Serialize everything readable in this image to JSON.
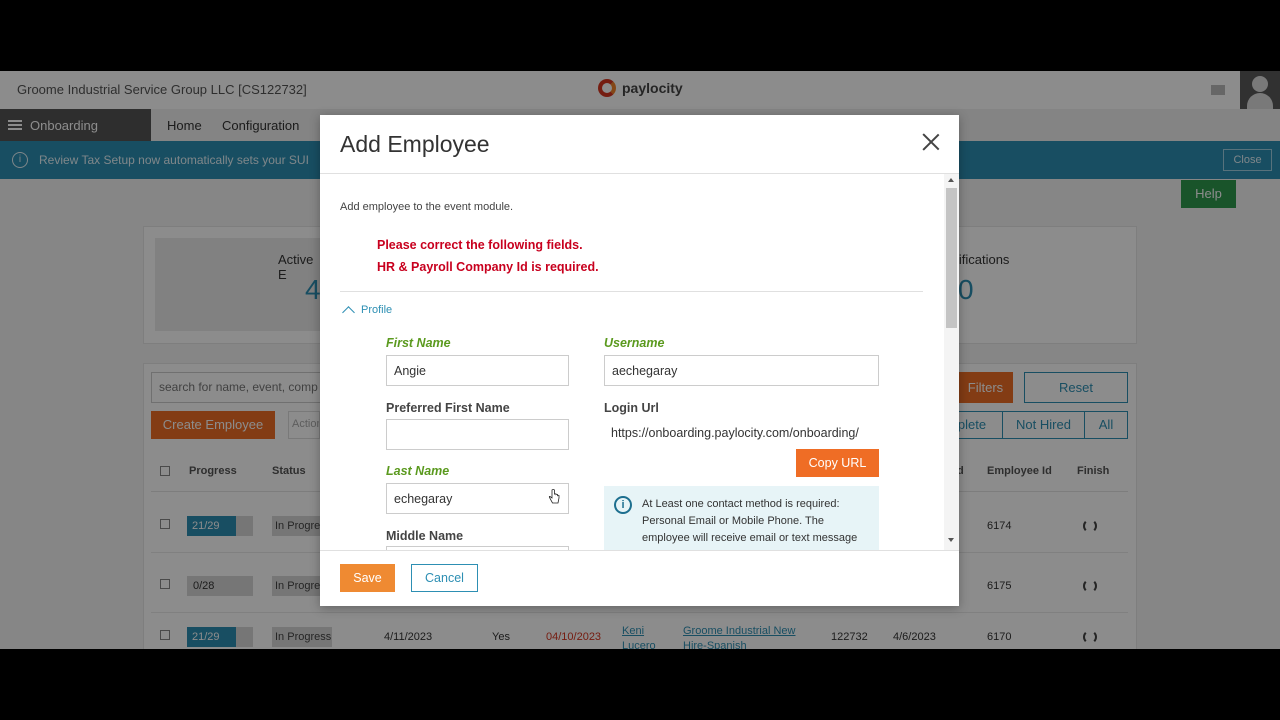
{
  "topbar": {
    "company": "Groome Industrial Service Group LLC [CS122732]",
    "brand": "paylocity"
  },
  "nav": {
    "app_label": "Onboarding",
    "links": [
      "Home",
      "Configuration"
    ]
  },
  "banner": {
    "text": "Review Tax Setup now automatically sets your SUI",
    "close_label": "Close"
  },
  "help_label": "Help",
  "stats": {
    "left_label": "Active E",
    "left_value": "4",
    "right_label": "otifications",
    "right_value": "0"
  },
  "toolbar": {
    "search_placeholder": "search for name, event, comp",
    "filters_label": "Filters",
    "reset_label": "Reset",
    "create_label": "Create Employee",
    "action_placeholder": "Action",
    "segments": [
      "plete",
      "Not Hired",
      "All"
    ]
  },
  "table": {
    "headers": [
      "Progress",
      "Status",
      "d",
      "Employee Id",
      "Finish"
    ],
    "rows": [
      {
        "progress": "21/29",
        "status": "In Progress",
        "employee_id": "6174"
      },
      {
        "progress": "0/28",
        "status": "In Progress",
        "employee_id": "6175"
      },
      {
        "progress": "21/29",
        "status": "In Progress",
        "start": "4/11/2023",
        "yes": "Yes",
        "due": "04/10/2023",
        "name": "Keni Lucero",
        "event": "Groome Industrial New Hire-Spanish",
        "company": "122732",
        "hire": "4/6/2023",
        "employee_id": "6170"
      }
    ]
  },
  "modal": {
    "title": "Add Employee",
    "description": "Add employee to the event module.",
    "errors": [
      "Please correct the following fields.",
      "HR & Payroll Company Id is required."
    ],
    "section_label": "Profile",
    "fields": {
      "first_name_label": "First Name",
      "first_name_value": "Angie",
      "preferred_first_name_label": "Preferred First Name",
      "preferred_first_name_value": "",
      "last_name_label": "Last Name",
      "last_name_value": "echegaray",
      "middle_name_label": "Middle Name",
      "username_label": "Username",
      "username_value": "aechegaray",
      "login_url_label": "Login Url",
      "login_url_value": "https://onboarding.paylocity.com/onboarding/"
    },
    "copy_url_label": "Copy URL",
    "info_text": "At Least one contact method is required: Personal Email or Mobile Phone. The employee will receive email or text message",
    "save_label": "Save",
    "cancel_label": "Cancel"
  },
  "colors": {
    "accent": "#2d8fb3",
    "orange": "#ef6d25",
    "error": "#c8001e",
    "required_label": "#5b9a1f"
  }
}
